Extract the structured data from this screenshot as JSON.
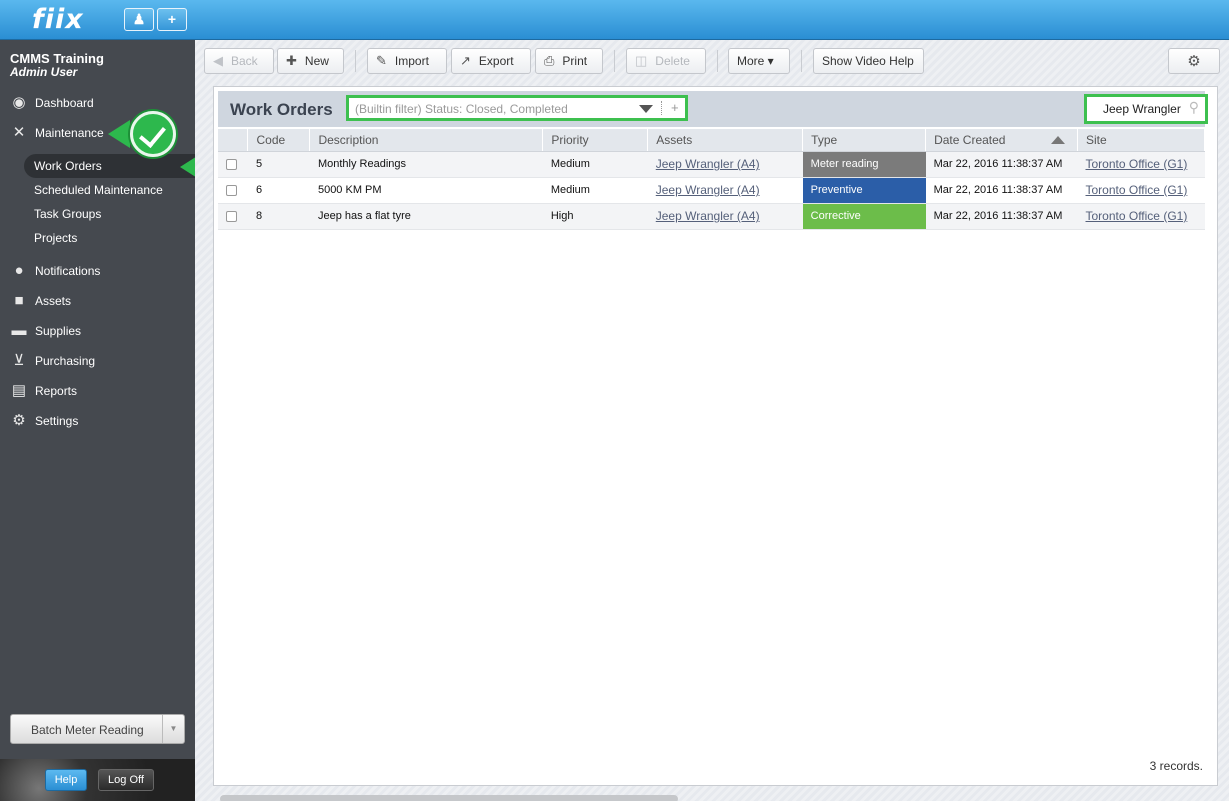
{
  "app": {
    "logo": "fiix"
  },
  "topbar": {
    "user_icon": "user-icon",
    "add_icon": "plus-icon",
    "add_label": "+"
  },
  "sidebar": {
    "org": "CMMS Training",
    "user": "Admin User",
    "items": [
      {
        "label": "Dashboard",
        "icon": "dashboard-icon",
        "glyph": "◉"
      },
      {
        "label": "Maintenance",
        "icon": "tools-icon",
        "glyph": "✕"
      },
      {
        "label": "Notifications",
        "icon": "chat-bubble-icon",
        "glyph": "●"
      },
      {
        "label": "Assets",
        "icon": "box-icon",
        "glyph": "■"
      },
      {
        "label": "Supplies",
        "icon": "truck-icon",
        "glyph": "▬"
      },
      {
        "label": "Purchasing",
        "icon": "cart-icon",
        "glyph": "⊻"
      },
      {
        "label": "Reports",
        "icon": "chart-icon",
        "glyph": "▤"
      },
      {
        "label": "Settings",
        "icon": "gear-icon",
        "glyph": "⚙"
      }
    ],
    "subitems": [
      "Work Orders",
      "Scheduled Maintenance",
      "Task Groups",
      "Projects"
    ],
    "batch_label": "Batch Meter Reading",
    "help_label": "Help",
    "logoff_label": "Log Off"
  },
  "toolbar": {
    "back": "Back",
    "new": "New",
    "import": "Import",
    "export": "Export",
    "print": "Print",
    "delete": "Delete",
    "more": "More ▾",
    "video_help": "Show Video Help"
  },
  "panel": {
    "title": "Work Orders",
    "filter_text": "(Builtin filter) Status: Closed, Completed",
    "filter_add": "+",
    "search_value": "Jeep Wrangler",
    "columns": [
      "",
      "Code",
      "Description",
      "Priority",
      "Assets",
      "Type",
      "Date Created",
      "Site"
    ],
    "rows": [
      {
        "code": "5",
        "description": "Monthly Readings",
        "priority": "Medium",
        "asset": "Jeep Wrangler (A4)",
        "type": "Meter reading",
        "type_color": "#7b7b7b",
        "date": "Mar 22, 2016 11:38:37 AM",
        "site": "Toronto Office (G1)"
      },
      {
        "code": "6",
        "description": "5000 KM PM",
        "priority": "Medium",
        "asset": "Jeep Wrangler (A4)",
        "type": "Preventive",
        "type_color": "#2b5ea8",
        "date": "Mar 22, 2016 11:38:37 AM",
        "site": "Toronto Office (G1)"
      },
      {
        "code": "8",
        "description": "Jeep has a flat tyre",
        "priority": "High",
        "asset": "Jeep Wrangler (A4)",
        "type": "Corrective",
        "type_color": "#6cbd4a",
        "date": "Mar 22, 2016 11:38:37 AM",
        "site": "Toronto Office (G1)"
      }
    ],
    "records": "3 records."
  },
  "colors": {
    "accent": "#2a8ed3",
    "highlight": "#3dc04f",
    "sidebar": "#45494f"
  }
}
